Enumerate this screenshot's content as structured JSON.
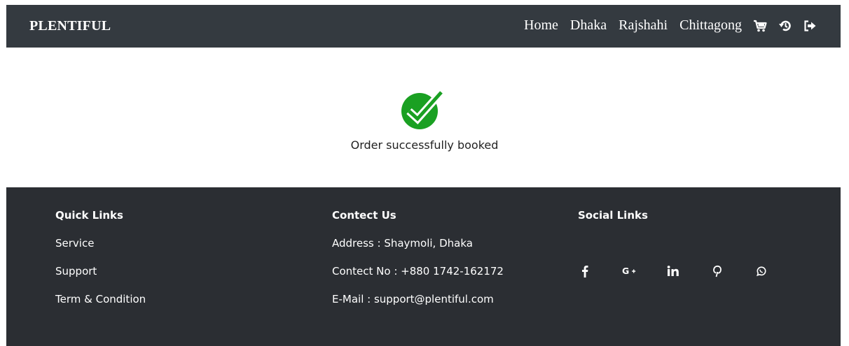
{
  "navbar": {
    "brand": "PLENTIFUL",
    "links": [
      "Home",
      "Dhaka",
      "Rajshahi",
      "Chittagong"
    ],
    "icons": [
      "cart-icon",
      "history-icon",
      "logout-icon"
    ]
  },
  "main": {
    "success_message": "Order successfully booked",
    "icon": "check-circle-icon",
    "accent_color": "#1aa022"
  },
  "footer": {
    "quick_links": {
      "title": "Quick Links",
      "items": [
        "Service",
        "Support",
        "Term & Condition"
      ]
    },
    "contact": {
      "title": "Contect Us",
      "address": "Address : Shaymoli, Dhaka",
      "phone": "Contect No : +880 1742-162172",
      "email": "E-Mail : support@plentiful.com"
    },
    "social": {
      "title": "Social Links",
      "icons": [
        "facebook-icon",
        "google-plus-icon",
        "linkedin-icon",
        "pinterest-icon",
        "whatsapp-icon"
      ]
    }
  }
}
